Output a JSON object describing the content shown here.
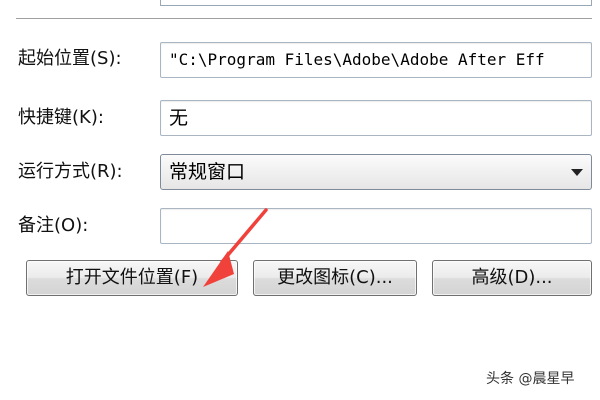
{
  "form": {
    "start_in_label": "起始位置(S):",
    "start_in_value": "\"C:\\Program Files\\Adobe\\Adobe After Eff",
    "shortcut_key_label": "快捷键(K):",
    "shortcut_key_value": "无",
    "run_label": "运行方式(R):",
    "run_value": "常规窗口",
    "comment_label": "备注(O):",
    "comment_value": ""
  },
  "buttons": {
    "open_file_location": "打开文件位置(F)",
    "change_icon": "更改图标(C)...",
    "advanced": "高级(D)..."
  },
  "annotation": {
    "arrow_color": "#f0413b"
  },
  "watermark": {
    "text": "头条 @晨星早"
  }
}
